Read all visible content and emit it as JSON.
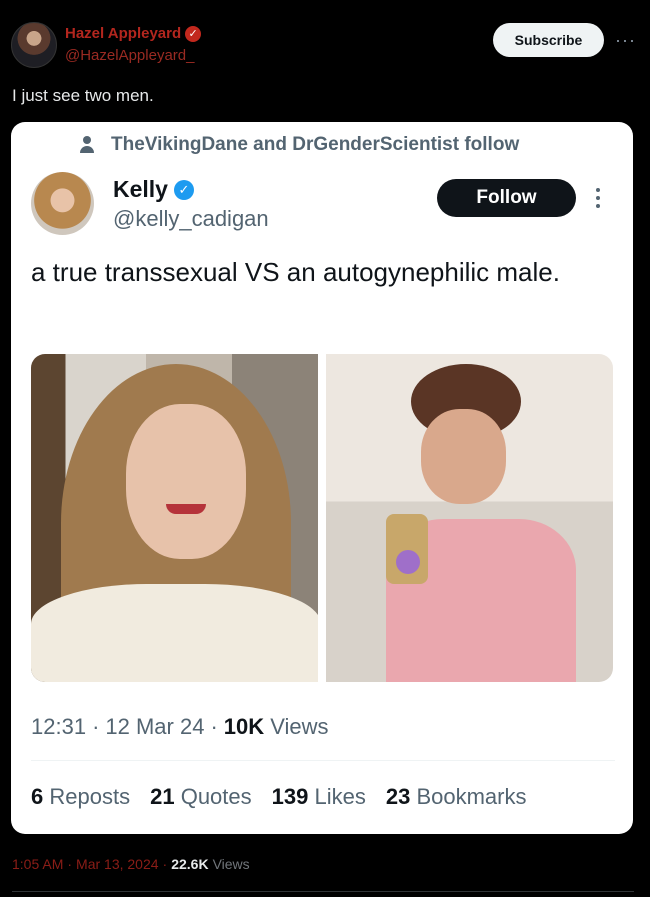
{
  "author": {
    "name": "Hazel Appleyard",
    "handle": "@HazelAppleyard_"
  },
  "actions": {
    "subscribe": "Subscribe",
    "more": "···"
  },
  "post": {
    "text": "I just see two men."
  },
  "quoted": {
    "social_context": "TheVikingDane and DrGenderScientist follow",
    "name": "Kelly",
    "handle": "@kelly_cadigan",
    "follow": "Follow",
    "text": "a true transsexual VS an autogynephilic male.",
    "time": "12:31",
    "date": "12 Mar 24",
    "views_count": "10K",
    "views_label": "Views",
    "reposts_count": "6",
    "reposts_label": "Reposts",
    "quotes_count": "21",
    "quotes_label": "Quotes",
    "likes_count": "139",
    "likes_label": "Likes",
    "bookmarks_count": "23",
    "bookmarks_label": "Bookmarks"
  },
  "footer": {
    "time": "1:05 AM",
    "date": "Mar 13, 2024",
    "views_count": "22.6K",
    "views_label": "Views"
  },
  "colors": {
    "brand_red": "#c2281d",
    "verified_blue": "#1d9bf0",
    "bg": "#000000"
  }
}
